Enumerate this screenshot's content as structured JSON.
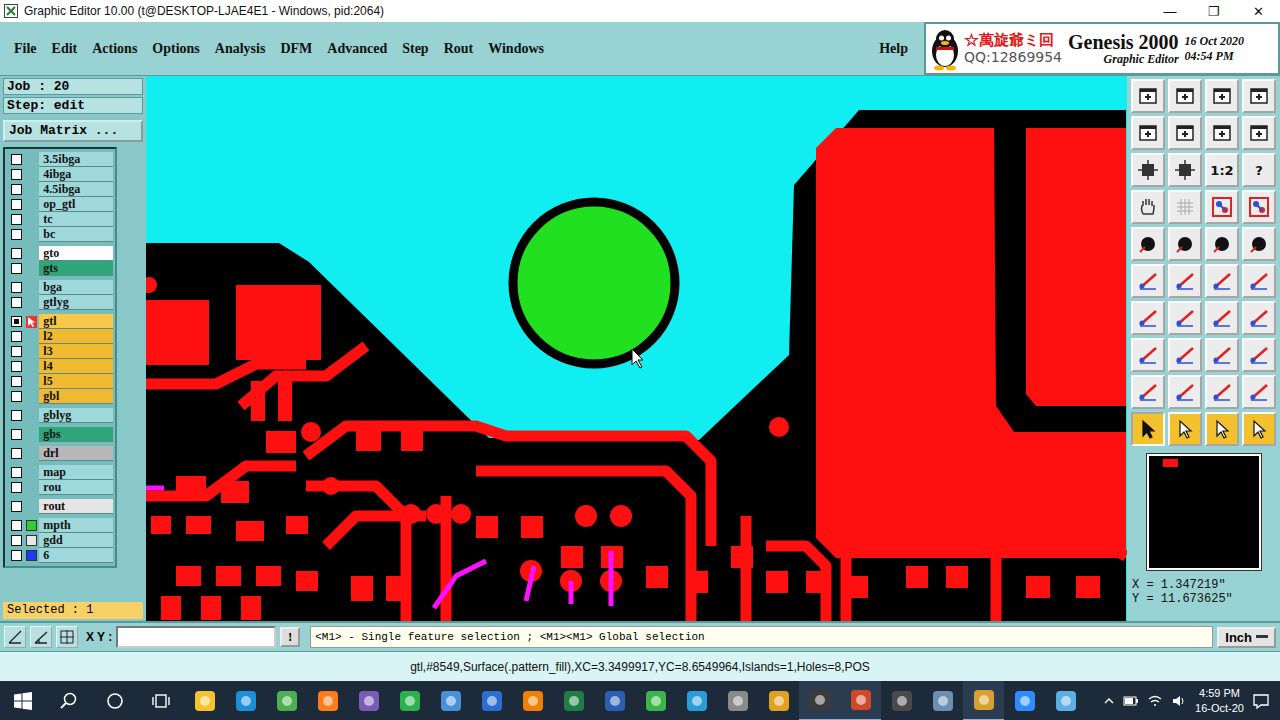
{
  "window": {
    "title": "Graphic Editor 10.00 (t@DESKTOP-LJAE4E1 - Windows, pid:2064)",
    "controls": [
      "—",
      "❐",
      "✕"
    ]
  },
  "menu": [
    "File",
    "Edit",
    "Actions",
    "Options",
    "Analysis",
    "DFM",
    "Advanced",
    "Step",
    "Rout",
    "Windows"
  ],
  "help": "Help",
  "logo": {
    "author": "☆萬旋爺ミ回",
    "qq": "QQ:12869954",
    "product": "Genesis 2000",
    "date": "16 Oct 2020",
    "time": "04:54 PM",
    "module": "Graphic Editor"
  },
  "job": {
    "job": "Job : 20",
    "step": "Step: edit",
    "matrix_button": "Job Matrix ..."
  },
  "layer_groups": [
    [
      {
        "name": "3.5ibga",
        "color": "#9fd8da",
        "checked": false,
        "work": false
      },
      {
        "name": "4ibga",
        "color": "#9fd8da",
        "checked": false,
        "work": false
      },
      {
        "name": "4.5ibga",
        "color": "#9fd8da",
        "checked": false,
        "work": false
      },
      {
        "name": "op_gtl",
        "color": "#9fd8da",
        "checked": false,
        "work": false
      },
      {
        "name": "tc",
        "color": "#9fd8da",
        "checked": false,
        "work": false
      },
      {
        "name": "bc",
        "color": "#9fd8da",
        "checked": false,
        "work": false
      }
    ],
    [
      {
        "name": "gto",
        "color": "#ffffff",
        "checked": false,
        "work": false
      },
      {
        "name": "gts",
        "color": "#2fa57a",
        "checked": false,
        "work": false
      }
    ],
    [
      {
        "name": "bga",
        "color": "#9fd8da",
        "checked": false,
        "work": false
      },
      {
        "name": "gtlyg",
        "color": "#9fd8da",
        "checked": false,
        "work": false
      }
    ],
    [
      {
        "name": "gtl",
        "color": "#f8c848",
        "checked": true,
        "work": true
      },
      {
        "name": "l2",
        "color": "#f0bb30",
        "checked": false,
        "work": false
      },
      {
        "name": "l3",
        "color": "#f0bb30",
        "checked": false,
        "work": false
      },
      {
        "name": "l4",
        "color": "#f0bb30",
        "checked": false,
        "work": false
      },
      {
        "name": "l5",
        "color": "#f0bb30",
        "checked": false,
        "work": false
      },
      {
        "name": "gbl",
        "color": "#f0bb30",
        "checked": false,
        "work": false
      }
    ],
    [
      {
        "name": "gblyg",
        "color": "#9fd8da",
        "checked": false,
        "work": false
      }
    ],
    [
      {
        "name": "gbs",
        "color": "#2fa57a",
        "checked": false,
        "work": false
      }
    ],
    [
      {
        "name": "drl",
        "color": "#b8b8b8",
        "checked": false,
        "work": false
      }
    ],
    [
      {
        "name": "map",
        "color": "#9fd8da",
        "checked": false,
        "work": false
      },
      {
        "name": "rou",
        "color": "#9fd8da",
        "checked": false,
        "work": false
      }
    ],
    [
      {
        "name": "rout",
        "color": "#e4e4e4",
        "checked": false,
        "work": false
      }
    ],
    [
      {
        "name": "mpth",
        "color": "#9fd8da",
        "checked": false,
        "work": false,
        "swatch": "#33cc33"
      },
      {
        "name": "gdd",
        "color": "#9fd8da",
        "checked": false,
        "work": false,
        "swatch": "#e8e8e8"
      },
      {
        "name": "6",
        "color": "#9fd8da",
        "checked": false,
        "work": false,
        "swatch": "#1a3cff"
      }
    ]
  ],
  "selected_count": "Selected : 1",
  "tools": [
    {
      "kind": "window",
      "selected": false
    },
    {
      "kind": "window",
      "selected": false
    },
    {
      "kind": "window",
      "selected": false
    },
    {
      "kind": "window",
      "selected": false
    },
    {
      "kind": "window",
      "selected": false
    },
    {
      "kind": "window",
      "selected": false
    },
    {
      "kind": "window",
      "selected": false
    },
    {
      "kind": "window",
      "selected": false
    },
    {
      "kind": "fit",
      "selected": false
    },
    {
      "kind": "fit",
      "selected": false
    },
    {
      "kind": "text",
      "label": "1:2",
      "selected": false
    },
    {
      "kind": "text",
      "label": "?",
      "selected": false
    },
    {
      "kind": "pan",
      "selected": false
    },
    {
      "kind": "grid",
      "selected": false
    },
    {
      "kind": "layers",
      "selected": false
    },
    {
      "kind": "layers",
      "selected": false
    },
    {
      "kind": "feature",
      "selected": false
    },
    {
      "kind": "feature",
      "selected": false
    },
    {
      "kind": "feature",
      "selected": false
    },
    {
      "kind": "feature",
      "selected": false
    },
    {
      "kind": "draw",
      "selected": false
    },
    {
      "kind": "draw",
      "selected": false
    },
    {
      "kind": "draw",
      "selected": false
    },
    {
      "kind": "draw",
      "selected": false
    },
    {
      "kind": "draw",
      "selected": false
    },
    {
      "kind": "draw",
      "selected": false
    },
    {
      "kind": "draw",
      "selected": false
    },
    {
      "kind": "draw",
      "selected": false
    },
    {
      "kind": "draw",
      "selected": false
    },
    {
      "kind": "draw",
      "selected": false
    },
    {
      "kind": "draw",
      "selected": false
    },
    {
      "kind": "draw",
      "selected": false
    },
    {
      "kind": "draw",
      "selected": false
    },
    {
      "kind": "draw",
      "selected": false
    },
    {
      "kind": "draw",
      "selected": false
    },
    {
      "kind": "draw",
      "selected": false
    },
    {
      "kind": "select",
      "selected": true
    },
    {
      "kind": "select",
      "selected": false
    },
    {
      "kind": "select",
      "selected": false
    },
    {
      "kind": "select",
      "selected": false
    }
  ],
  "coords": {
    "x": "X = 1.347219\"",
    "y": "Y = 11.673625\""
  },
  "input": {
    "label": "X Y :",
    "value": "",
    "go": "!"
  },
  "hint": "<M1> - Single feature selection ; <M1><M1> Global selection",
  "units": "Inch",
  "status": "gtl,#8549,Surface(.pattern_fill),XC=3.3499917,YC=8.6549964,Islands=1,Holes=8,POS",
  "taskbar": {
    "apps": [
      {
        "color": "#f4c430",
        "running": false
      },
      {
        "color": "#1b8fd8",
        "running": false
      },
      {
        "color": "#4caf50",
        "running": false
      },
      {
        "color": "#ff7a1a",
        "running": false
      },
      {
        "color": "#7a5cb8",
        "running": false
      },
      {
        "color": "#2bb24c",
        "running": false
      },
      {
        "color": "#4a90d9",
        "running": false
      },
      {
        "color": "#2a6fd0",
        "running": false
      },
      {
        "color": "#f08000",
        "running": false
      },
      {
        "color": "#1e7e45",
        "running": false
      },
      {
        "color": "#2b5fb4",
        "running": false
      },
      {
        "color": "#3bb54a",
        "running": false
      },
      {
        "color": "#2b9cd8",
        "running": false
      },
      {
        "color": "#8a8a8a",
        "running": false
      },
      {
        "color": "#e0a020",
        "running": false
      },
      {
        "color": "#3a3a3a",
        "running": true
      },
      {
        "color": "#d04a2a",
        "running": true
      },
      {
        "color": "#4a4a4a",
        "running": false
      },
      {
        "color": "#6a8fb0",
        "running": false
      },
      {
        "color": "#d8a030",
        "running": true
      },
      {
        "color": "#2d8cff",
        "running": false
      },
      {
        "color": "#5ab0e0",
        "running": false
      }
    ],
    "time": "4:59 PM",
    "date": "16-Oct-20"
  }
}
